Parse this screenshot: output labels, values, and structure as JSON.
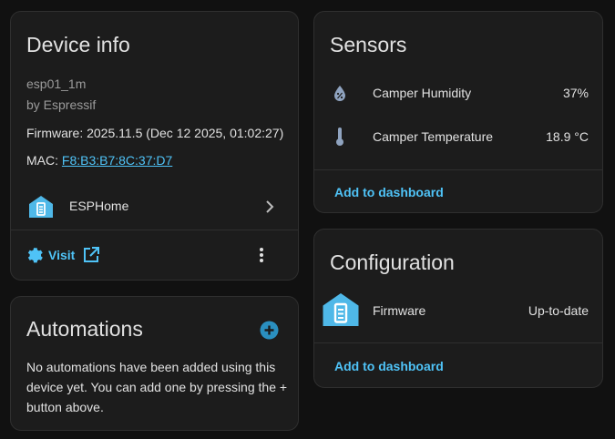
{
  "device_info": {
    "title": "Device info",
    "model": "esp01_1m",
    "manufacturer": "by Espressif",
    "firmware": "Firmware: 2025.11.5 (Dec 12 2025, 01:02:27)",
    "mac_label": "MAC: ",
    "mac_value": "F8:B3:B7:8C:37:D7",
    "integration": "ESPHome",
    "visit_label": "Visit"
  },
  "automations": {
    "title": "Automations",
    "empty_text": "No automations have been added using this device yet. You can add one by pressing the + button above."
  },
  "sensors": {
    "title": "Sensors",
    "items": [
      {
        "name": "Camper Humidity",
        "value": "37%",
        "icon": "water-percent-icon"
      },
      {
        "name": "Camper Temperature",
        "value": "18.9 °C",
        "icon": "thermometer-icon"
      }
    ],
    "add_label": "Add to dashboard"
  },
  "configuration": {
    "title": "Configuration",
    "items": [
      {
        "name": "Firmware",
        "value": "Up-to-date",
        "icon": "esphome-icon"
      }
    ],
    "add_label": "Add to dashboard"
  },
  "colors": {
    "accent": "#4fc3f7",
    "card_bg": "#1c1c1c",
    "page_bg": "#111111",
    "icon_blue": "#4fb8e8",
    "add_circle": "#2a8fbf"
  }
}
